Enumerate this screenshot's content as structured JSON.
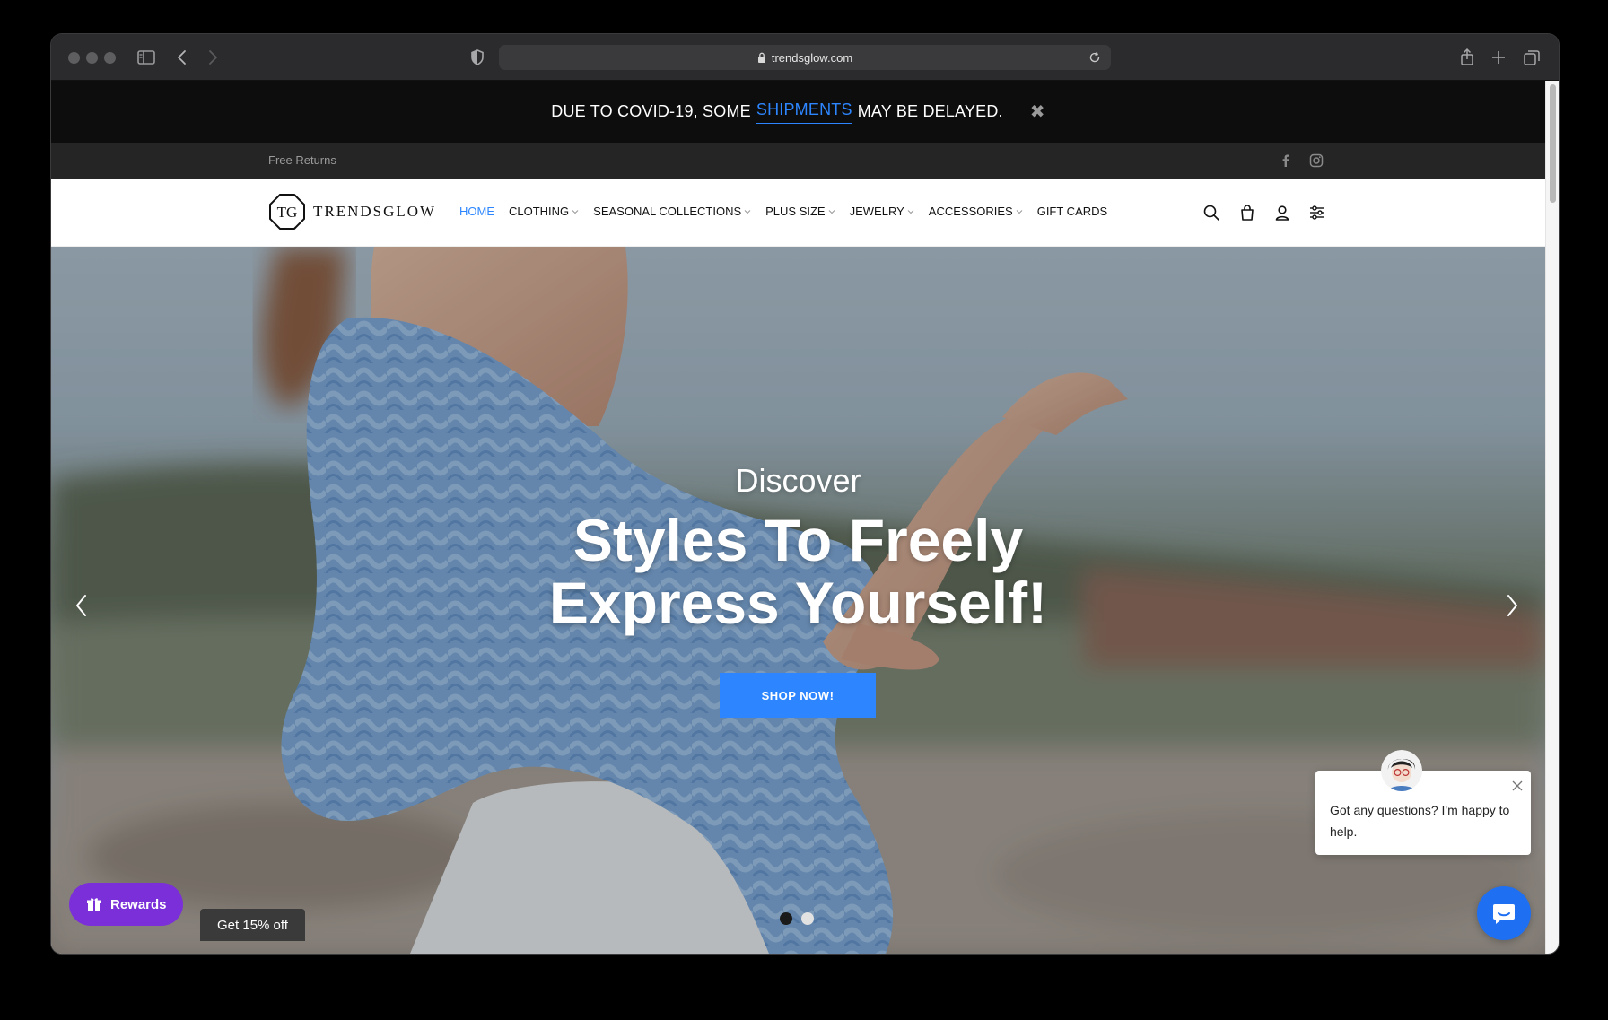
{
  "browser": {
    "url": "trendsglow.com"
  },
  "announcement": {
    "prefix": "DUE TO COVID-19, SOME",
    "highlight": "SHIPMENTS",
    "suffix": "MAY BE DELAYED.",
    "close_glyph": "✖"
  },
  "topbar": {
    "left_text": "Free Returns",
    "social_icons": [
      "facebook-icon",
      "instagram-icon"
    ]
  },
  "header": {
    "logo_mark": "TG",
    "logo_word": "TRENDSGLOW",
    "menu": [
      {
        "label": "HOME",
        "active": true,
        "dropdown": false
      },
      {
        "label": "CLOTHING",
        "active": false,
        "dropdown": true
      },
      {
        "label": "SEASONAL COLLECTIONS",
        "active": false,
        "dropdown": true
      },
      {
        "label": "PLUS SIZE",
        "active": false,
        "dropdown": true
      },
      {
        "label": "JEWELRY",
        "active": false,
        "dropdown": true
      },
      {
        "label": "ACCESSORIES",
        "active": false,
        "dropdown": true
      },
      {
        "label": "GIFT CARDS",
        "active": false,
        "dropdown": false
      }
    ],
    "icons": [
      "search-icon",
      "bag-icon",
      "user-icon",
      "settings-icon"
    ]
  },
  "hero": {
    "subtitle": "Discover",
    "title_line1": "Styles To Freely",
    "title_line2": "Express Yourself!",
    "cta_label": "SHOP NOW!",
    "slide_count": 2,
    "active_slide": 1
  },
  "widgets": {
    "rewards_label": "Rewards",
    "discount_label": "Get 15% off",
    "chat_message": "Got any questions? I'm happy to help."
  },
  "colors": {
    "accent": "#2d86ff",
    "rewards": "#7a2fd9",
    "chat": "#1e6ff2"
  }
}
